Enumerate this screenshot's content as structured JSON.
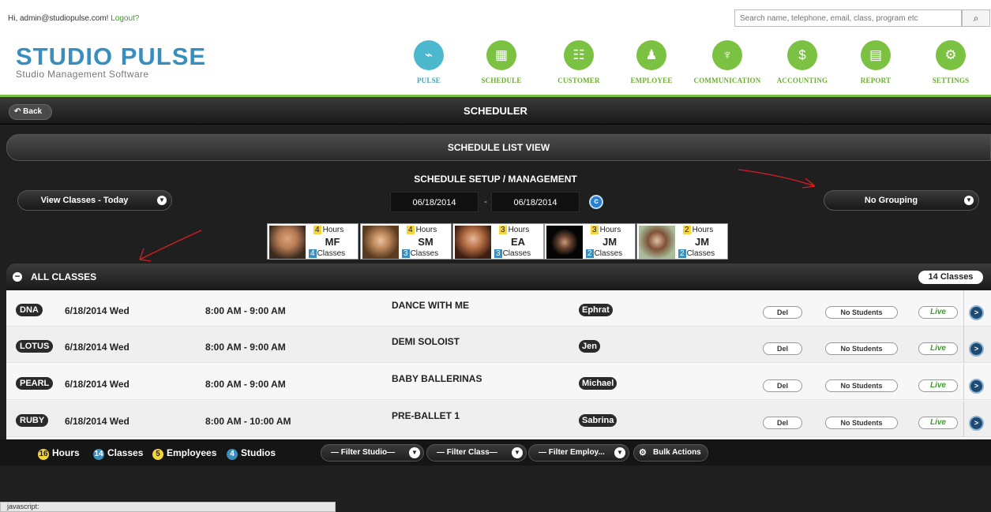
{
  "header": {
    "greeting": "Hi, admin@studiopulse.com!",
    "logout": "Logout?",
    "search_placeholder": "Search name, telephone, email, class, program etc",
    "search_icon": "magnifier-icon"
  },
  "logo": {
    "title": "STUDIO PULSE",
    "subtitle": "Studio Management Software"
  },
  "nav": [
    {
      "label": "PULSE",
      "icon": "pulse-icon",
      "glyph": "⌁",
      "active": true
    },
    {
      "label": "SCHEDULE",
      "icon": "calendar-icon",
      "glyph": "▦"
    },
    {
      "label": "CUSTOMER",
      "icon": "customer-icon",
      "glyph": "☷"
    },
    {
      "label": "EMPLOYEE",
      "icon": "employee-icon",
      "glyph": "♟"
    },
    {
      "label": "COMMUNICATION",
      "icon": "antenna-icon",
      "glyph": "♆"
    },
    {
      "label": "ACCOUNTING",
      "icon": "accounting-icon",
      "glyph": "$"
    },
    {
      "label": "REPORT",
      "icon": "report-icon",
      "glyph": "▤"
    },
    {
      "label": "SETTINGS",
      "icon": "gear-icon",
      "glyph": "⚙"
    }
  ],
  "titlebar": {
    "back": "Back",
    "title": "SCHEDULER"
  },
  "list_view": "SCHEDULE LIST VIEW",
  "setup": {
    "title": "SCHEDULE SETUP / MANAGEMENT",
    "view_select": "View Classes - Today",
    "date_from": "06/18/2014",
    "date_to": "06/18/2014",
    "dash": "-",
    "grouping": "No Grouping"
  },
  "instructors": [
    {
      "hours": "4",
      "hours_label": "Hours",
      "initials": "MF",
      "classes": "4",
      "classes_label": "Classes"
    },
    {
      "hours": "4",
      "hours_label": "Hours",
      "initials": "SM",
      "classes": "3",
      "classes_label": "Classes"
    },
    {
      "hours": "3",
      "hours_label": "Hours",
      "initials": "EA",
      "classes": "3",
      "classes_label": "Classes"
    },
    {
      "hours": "3",
      "hours_label": "Hours",
      "initials": "JM",
      "classes": "2",
      "classes_label": "Classes"
    },
    {
      "hours": "2",
      "hours_label": "Hours",
      "initials": "JM",
      "classes": "2",
      "classes_label": "Classes"
    }
  ],
  "section": {
    "title": "ALL CLASSES",
    "count": "14 Classes"
  },
  "rows": [
    {
      "studio": "DNA",
      "date": "6/18/2014  Wed",
      "time": "8:00 AM - 9:00 AM",
      "class": "DANCE WITH ME",
      "employee": "Ephrat",
      "del": "Del",
      "students": "No Students",
      "status": "Live"
    },
    {
      "studio": "LOTUS",
      "date": "6/18/2014  Wed",
      "time": "8:00 AM - 9:00 AM",
      "class": "DEMI SOLOIST",
      "employee": "Jen",
      "del": "Del",
      "students": "No Students",
      "status": "Live"
    },
    {
      "studio": "PEARL",
      "date": "6/18/2014  Wed",
      "time": "8:00 AM - 9:00 AM",
      "class": "BABY BALLERINAS",
      "employee": "Michael",
      "del": "Del",
      "students": "No Students",
      "status": "Live"
    },
    {
      "studio": "RUBY",
      "date": "6/18/2014  Wed",
      "time": "8:00 AM - 10:00 AM",
      "class": "PRE-BALLET 1",
      "employee": "Sabrina",
      "del": "Del",
      "students": "No Students",
      "status": "Live"
    }
  ],
  "footer": {
    "hours": "16",
    "hours_label": "Hours",
    "classes": "14",
    "classes_label": "Classes",
    "employees": "5",
    "employees_label": "Employees",
    "studios": "4",
    "studios_label": "Studios",
    "filter_studio": "— Filter Studio—",
    "filter_class": "— Filter Class—",
    "filter_employee": "— Filter Employ...",
    "bulk": "Bulk Actions"
  },
  "statusbar": "javascript:",
  "colors": {
    "accent_green": "#7cc242",
    "accent_blue": "#4cb8cd",
    "annotation_red": "#d81e1e"
  }
}
